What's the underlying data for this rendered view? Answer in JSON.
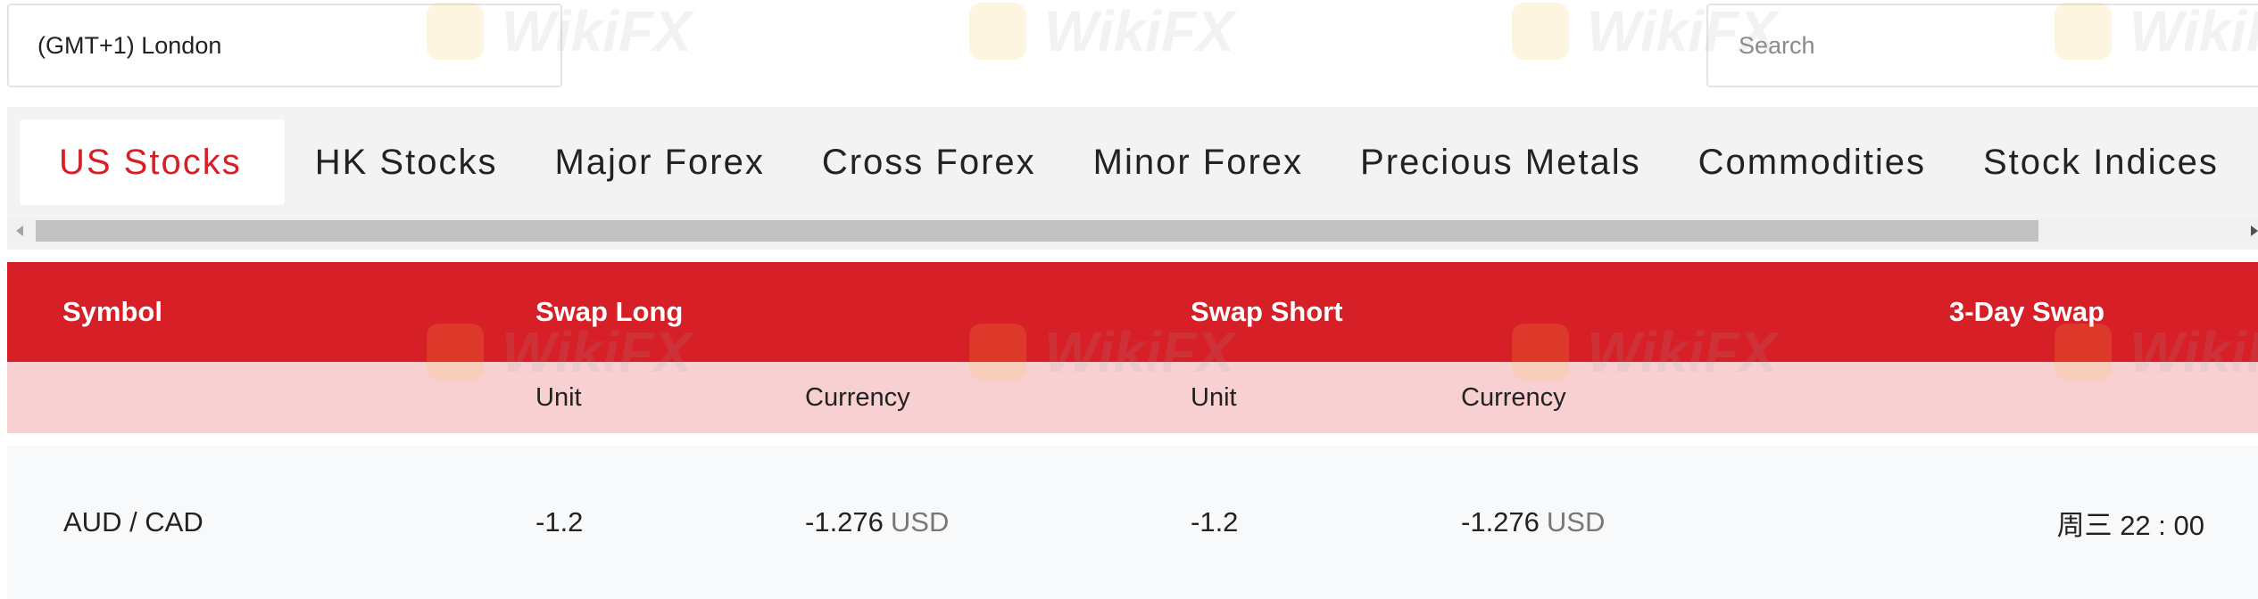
{
  "timezone": {
    "value": "(GMT+1) London"
  },
  "search": {
    "placeholder": "Search"
  },
  "tabs": [
    {
      "label": "US Stocks",
      "active": true
    },
    {
      "label": "HK Stocks"
    },
    {
      "label": "Major Forex"
    },
    {
      "label": "Cross Forex"
    },
    {
      "label": "Minor Forex"
    },
    {
      "label": "Precious Metals"
    },
    {
      "label": "Commodities"
    },
    {
      "label": "Stock Indices"
    }
  ],
  "table": {
    "headers": {
      "symbol": "Symbol",
      "swap_long": "Swap Long",
      "swap_short": "Swap Short",
      "three_day": "3-Day Swap"
    },
    "subheaders": {
      "long_unit": "Unit",
      "long_currency": "Currency",
      "short_unit": "Unit",
      "short_currency": "Currency"
    },
    "rows": [
      {
        "symbol": "AUD / CAD",
        "long_unit": "-1.2",
        "long_currency_value": "-1.276",
        "long_currency_code": "USD",
        "short_unit": "-1.2",
        "short_currency_value": "-1.276",
        "short_currency_code": "USD",
        "three_day": "周三 22 : 00"
      }
    ]
  },
  "watermark": {
    "text": "WikiFX"
  },
  "colors": {
    "accent": "#d71f27",
    "subheader_bg": "#f8d0d1",
    "tab_bar_bg": "#f3f3f3"
  }
}
